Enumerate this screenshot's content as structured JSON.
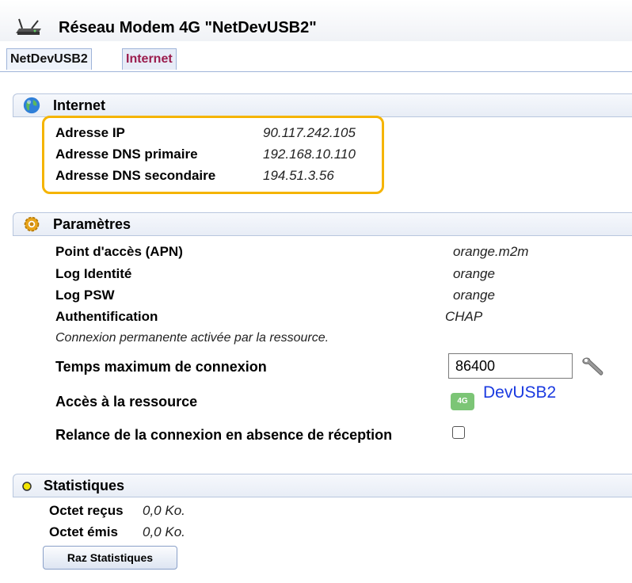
{
  "header": {
    "title": "Réseau Modem 4G \"NetDevUSB2\"",
    "logo_icon": "network-modem-icon"
  },
  "tabs": [
    {
      "label": "NetDevUSB2"
    },
    {
      "label": "Internet"
    }
  ],
  "internet": {
    "title": "Internet",
    "icon": "globe-icon",
    "rows": [
      {
        "label": "Adresse IP",
        "value": "90.117.242.105"
      },
      {
        "label": "Adresse DNS primaire",
        "value": "192.168.10.110"
      },
      {
        "label": "Adresse DNS secondaire",
        "value": "194.51.3.56"
      }
    ],
    "highlight_color": "#f5b400"
  },
  "params": {
    "title": "Paramètres",
    "icon": "gear-icon",
    "rows": [
      {
        "label": "Point d'accès (APN)",
        "value": "orange.m2m"
      },
      {
        "label": "Log Identité",
        "value": "orange"
      },
      {
        "label": "Log PSW",
        "value": "orange"
      },
      {
        "label": "Authentification",
        "value": "CHAP"
      }
    ],
    "note": "Connexion permanente activée par la ressource.",
    "max_time_label": "Temps maximum de connexion",
    "max_time_value": "86400",
    "resource_label": "Accès à la ressource",
    "resource_badge": "4G",
    "resource_link": "DevUSB2",
    "relaunch_label": "Relance de la connexion en absence de réception"
  },
  "stats": {
    "title": "Statistiques",
    "received_label": "Octet reçus",
    "received_value": "0,0 Ko.",
    "sent_label": "Octet émis",
    "sent_value": "0,0 Ko.",
    "reset_button": "Raz Statistiques"
  }
}
